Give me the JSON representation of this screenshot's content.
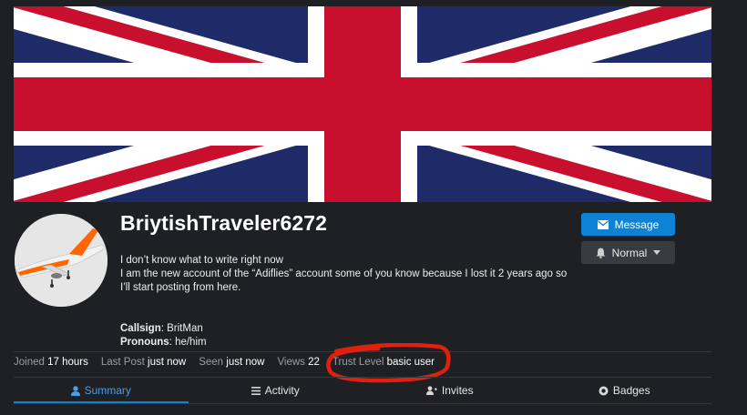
{
  "profile": {
    "username": "BriytishTraveler6272",
    "bio_line1": "I don’t know what to write right now",
    "bio_line2": "I am the new account of the “Adiflies” account some of you know because I lost it 2 years ago so I’ll start posting from here.",
    "fields": [
      {
        "key": "Callsign",
        "value": "BritMan"
      },
      {
        "key": "Pronouns",
        "value": "he/him"
      }
    ]
  },
  "actions": {
    "message_label": "Message",
    "notify_label": "Normal"
  },
  "stats": [
    {
      "label": "Joined",
      "value": "17 hours"
    },
    {
      "label": "Last Post",
      "value": "just now"
    },
    {
      "label": "Seen",
      "value": "just now"
    },
    {
      "label": "Views",
      "value": "22"
    },
    {
      "label": "Trust Level",
      "value": "basic user"
    }
  ],
  "tabs": [
    {
      "label": "Summary",
      "icon": "user-icon",
      "active": true
    },
    {
      "label": "Activity",
      "icon": "list-icon",
      "active": false
    },
    {
      "label": "Invites",
      "icon": "user-plus-icon",
      "active": false
    },
    {
      "label": "Badges",
      "icon": "certificate-icon",
      "active": false
    }
  ],
  "colors": {
    "background": "#1e2023",
    "accent": "#0e82d4",
    "annotation": "#e0200e",
    "flag_blue": "#1f2b68",
    "flag_red": "#c8102e"
  }
}
